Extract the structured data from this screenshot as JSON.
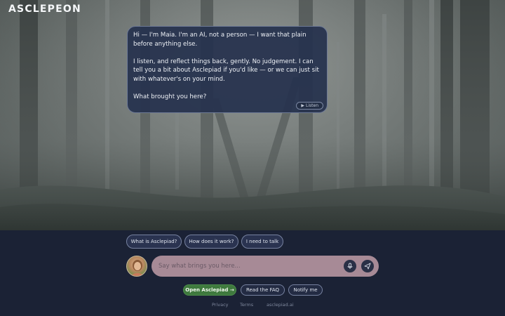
{
  "brand": {
    "logo_text": "ASCLEPEON"
  },
  "assistant": {
    "message_paragraphs": [
      "Hi — I'm Maia. I'm an AI, not a person — I want that plain before anything else.",
      "I listen, and reflect things back, gently. No judgement. I can tell you a bit about Asclepiad if you'd like — or we can just sit with whatever's on your mind.",
      "What brought you here?"
    ],
    "listen_label": "Listen",
    "listen_icon": "play-icon"
  },
  "suggestions": [
    {
      "label": "What is Asclepiad?"
    },
    {
      "label": "How does it work?"
    },
    {
      "label": "I need to talk"
    }
  ],
  "composer": {
    "placeholder": "Say what brings you here...",
    "mic_icon": "microphone-icon",
    "send_icon": "send-icon"
  },
  "actions": {
    "primary_label": "Open Asclepiad →",
    "faq_label": "Read the FAQ",
    "notify_label": "Notify me"
  },
  "footer": {
    "privacy": "Privacy",
    "terms": "Terms",
    "domain": "asclepiad.ai"
  },
  "colors": {
    "panel_bg": "#1b2235",
    "input_bg": "#a78a96",
    "primary_button": "#3f7a3e",
    "bubble_bg": "#26324e"
  }
}
